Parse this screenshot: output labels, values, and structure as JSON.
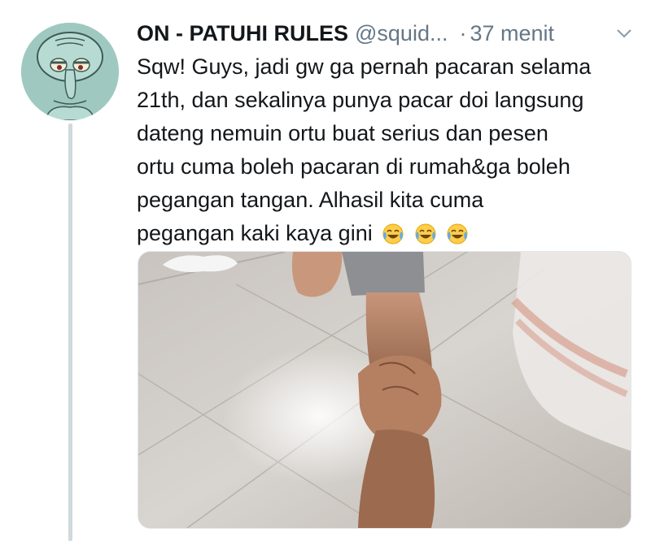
{
  "tweet": {
    "display_name": "ON - PATUHI RULES",
    "handle": "@squid...",
    "separator": "·",
    "time": "37 menit",
    "text_lines": [
      "Sqw! Guys, jadi gw ga pernah pacaran selama",
      "21th, dan sekalinya punya pacar doi langsung",
      "dateng nemuin ortu buat serius dan pesen",
      "ortu cuma boleh pacaran di rumah&ga boleh",
      "pegangan tangan. Alhasil kita cuma",
      "pegangan kaki kaya gini"
    ],
    "emojis": [
      "face-with-tears-of-joy-icon",
      "face-with-tears-of-joy-icon",
      "face-with-tears-of-joy-icon"
    ]
  },
  "icons": {
    "avatar": "squidward-avatar",
    "menu": "chevron-down-icon"
  },
  "colors": {
    "name": "#14171a",
    "secondary": "#657786",
    "thread_line": "#cfd9de",
    "avatar_bg": "#9fc9c0"
  }
}
